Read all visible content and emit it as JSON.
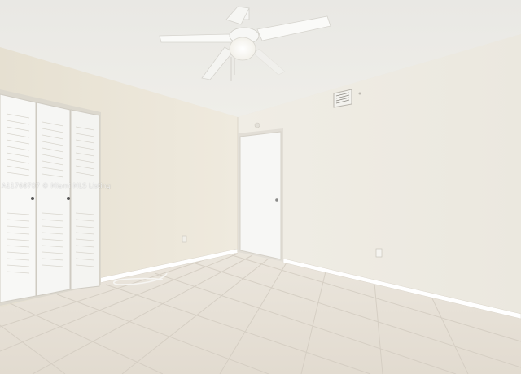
{
  "scene": {
    "description_free": true,
    "colors": {
      "ceiling": "#ecebe7",
      "left_wall": "#ece7da",
      "back_wall": "#efece4",
      "floor_tile": "#e6e0d6",
      "grout": "#d2cbc0",
      "baseboard": "#ffffff",
      "door": "#f7f7f5",
      "closet_door": "#f8f8f6"
    },
    "icons": [
      "ceiling-fan-icon",
      "air-vent-icon",
      "outlet-icon",
      "door-knob-icon"
    ]
  },
  "watermark": {
    "text": "A11768707 © Miami MLS Listing"
  }
}
